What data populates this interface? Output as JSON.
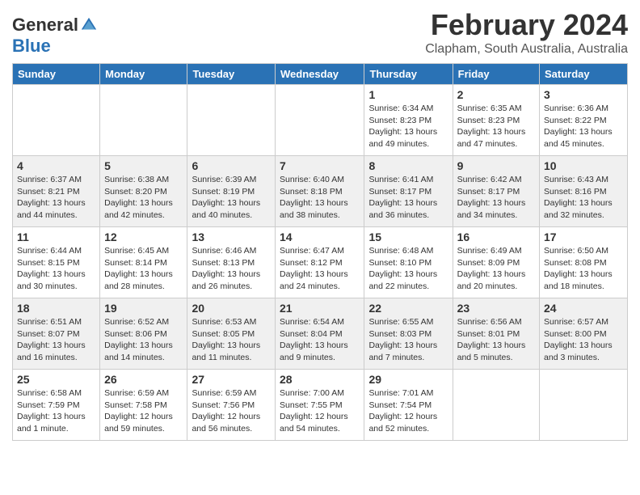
{
  "header": {
    "logo_general": "General",
    "logo_blue": "Blue",
    "month_title": "February 2024",
    "location": "Clapham, South Australia, Australia"
  },
  "days_of_week": [
    "Sunday",
    "Monday",
    "Tuesday",
    "Wednesday",
    "Thursday",
    "Friday",
    "Saturday"
  ],
  "weeks": [
    [
      {
        "day": "",
        "info": ""
      },
      {
        "day": "",
        "info": ""
      },
      {
        "day": "",
        "info": ""
      },
      {
        "day": "",
        "info": ""
      },
      {
        "day": "1",
        "info": "Sunrise: 6:34 AM\nSunset: 8:23 PM\nDaylight: 13 hours and 49 minutes."
      },
      {
        "day": "2",
        "info": "Sunrise: 6:35 AM\nSunset: 8:23 PM\nDaylight: 13 hours and 47 minutes."
      },
      {
        "day": "3",
        "info": "Sunrise: 6:36 AM\nSunset: 8:22 PM\nDaylight: 13 hours and 45 minutes."
      }
    ],
    [
      {
        "day": "4",
        "info": "Sunrise: 6:37 AM\nSunset: 8:21 PM\nDaylight: 13 hours and 44 minutes."
      },
      {
        "day": "5",
        "info": "Sunrise: 6:38 AM\nSunset: 8:20 PM\nDaylight: 13 hours and 42 minutes."
      },
      {
        "day": "6",
        "info": "Sunrise: 6:39 AM\nSunset: 8:19 PM\nDaylight: 13 hours and 40 minutes."
      },
      {
        "day": "7",
        "info": "Sunrise: 6:40 AM\nSunset: 8:18 PM\nDaylight: 13 hours and 38 minutes."
      },
      {
        "day": "8",
        "info": "Sunrise: 6:41 AM\nSunset: 8:17 PM\nDaylight: 13 hours and 36 minutes."
      },
      {
        "day": "9",
        "info": "Sunrise: 6:42 AM\nSunset: 8:17 PM\nDaylight: 13 hours and 34 minutes."
      },
      {
        "day": "10",
        "info": "Sunrise: 6:43 AM\nSunset: 8:16 PM\nDaylight: 13 hours and 32 minutes."
      }
    ],
    [
      {
        "day": "11",
        "info": "Sunrise: 6:44 AM\nSunset: 8:15 PM\nDaylight: 13 hours and 30 minutes."
      },
      {
        "day": "12",
        "info": "Sunrise: 6:45 AM\nSunset: 8:14 PM\nDaylight: 13 hours and 28 minutes."
      },
      {
        "day": "13",
        "info": "Sunrise: 6:46 AM\nSunset: 8:13 PM\nDaylight: 13 hours and 26 minutes."
      },
      {
        "day": "14",
        "info": "Sunrise: 6:47 AM\nSunset: 8:12 PM\nDaylight: 13 hours and 24 minutes."
      },
      {
        "day": "15",
        "info": "Sunrise: 6:48 AM\nSunset: 8:10 PM\nDaylight: 13 hours and 22 minutes."
      },
      {
        "day": "16",
        "info": "Sunrise: 6:49 AM\nSunset: 8:09 PM\nDaylight: 13 hours and 20 minutes."
      },
      {
        "day": "17",
        "info": "Sunrise: 6:50 AM\nSunset: 8:08 PM\nDaylight: 13 hours and 18 minutes."
      }
    ],
    [
      {
        "day": "18",
        "info": "Sunrise: 6:51 AM\nSunset: 8:07 PM\nDaylight: 13 hours and 16 minutes."
      },
      {
        "day": "19",
        "info": "Sunrise: 6:52 AM\nSunset: 8:06 PM\nDaylight: 13 hours and 14 minutes."
      },
      {
        "day": "20",
        "info": "Sunrise: 6:53 AM\nSunset: 8:05 PM\nDaylight: 13 hours and 11 minutes."
      },
      {
        "day": "21",
        "info": "Sunrise: 6:54 AM\nSunset: 8:04 PM\nDaylight: 13 hours and 9 minutes."
      },
      {
        "day": "22",
        "info": "Sunrise: 6:55 AM\nSunset: 8:03 PM\nDaylight: 13 hours and 7 minutes."
      },
      {
        "day": "23",
        "info": "Sunrise: 6:56 AM\nSunset: 8:01 PM\nDaylight: 13 hours and 5 minutes."
      },
      {
        "day": "24",
        "info": "Sunrise: 6:57 AM\nSunset: 8:00 PM\nDaylight: 13 hours and 3 minutes."
      }
    ],
    [
      {
        "day": "25",
        "info": "Sunrise: 6:58 AM\nSunset: 7:59 PM\nDaylight: 13 hours and 1 minute."
      },
      {
        "day": "26",
        "info": "Sunrise: 6:59 AM\nSunset: 7:58 PM\nDaylight: 12 hours and 59 minutes."
      },
      {
        "day": "27",
        "info": "Sunrise: 6:59 AM\nSunset: 7:56 PM\nDaylight: 12 hours and 56 minutes."
      },
      {
        "day": "28",
        "info": "Sunrise: 7:00 AM\nSunset: 7:55 PM\nDaylight: 12 hours and 54 minutes."
      },
      {
        "day": "29",
        "info": "Sunrise: 7:01 AM\nSunset: 7:54 PM\nDaylight: 12 hours and 52 minutes."
      },
      {
        "day": "",
        "info": ""
      },
      {
        "day": "",
        "info": ""
      }
    ]
  ]
}
